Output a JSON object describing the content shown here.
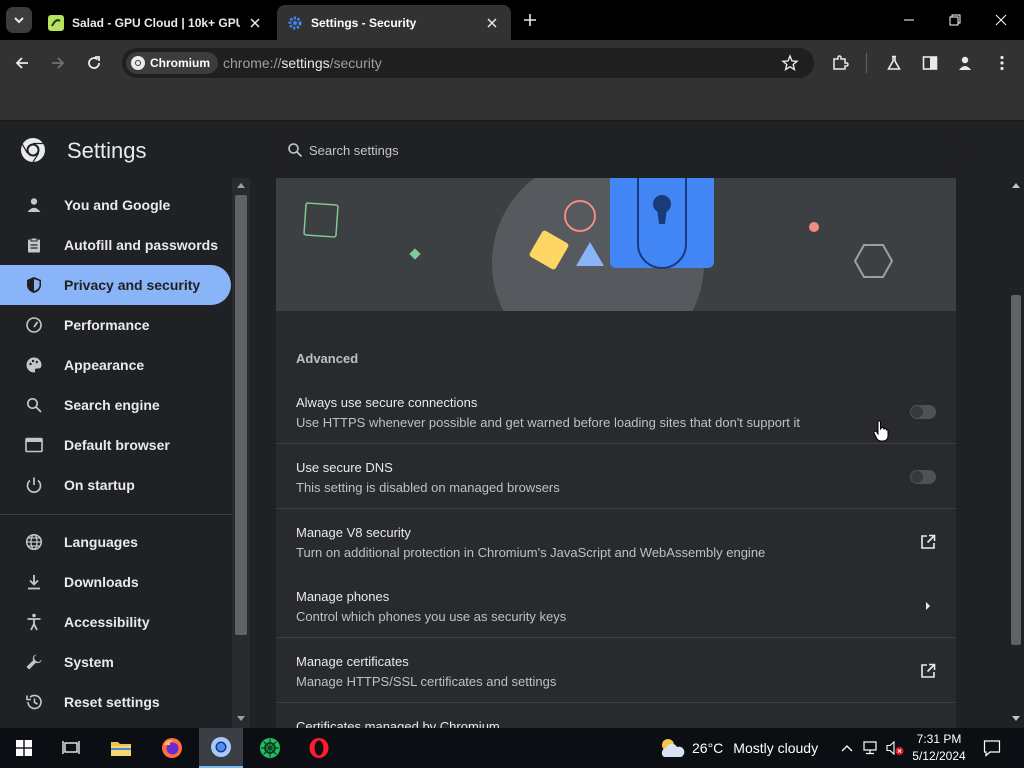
{
  "tabs": [
    {
      "title": "Salad - GPU Cloud | 10k+ GPU",
      "active": false
    },
    {
      "title": "Settings - Security",
      "active": true
    }
  ],
  "toolbar": {
    "site_chip": "Chromium",
    "url_scheme": "chrome://",
    "url_host": "settings",
    "url_path": "/security"
  },
  "header": {
    "title": "Settings",
    "search_placeholder": "Search settings"
  },
  "sidebar": {
    "items": [
      {
        "label": "You and Google",
        "icon": "person-icon",
        "selected": false
      },
      {
        "label": "Autofill and passwords",
        "icon": "clipboard-icon",
        "selected": false
      },
      {
        "label": "Privacy and security",
        "icon": "shield-icon",
        "selected": true
      },
      {
        "label": "Performance",
        "icon": "speedometer-icon",
        "selected": false
      },
      {
        "label": "Appearance",
        "icon": "palette-icon",
        "selected": false
      },
      {
        "label": "Search engine",
        "icon": "search-icon",
        "selected": false
      },
      {
        "label": "Default browser",
        "icon": "browser-icon",
        "selected": false
      },
      {
        "label": "On startup",
        "icon": "power-icon",
        "selected": false
      },
      {
        "label": "Languages",
        "icon": "globe-icon",
        "selected": false
      },
      {
        "label": "Downloads",
        "icon": "download-icon",
        "selected": false
      },
      {
        "label": "Accessibility",
        "icon": "accessibility-icon",
        "selected": false
      },
      {
        "label": "System",
        "icon": "wrench-icon",
        "selected": false
      },
      {
        "label": "Reset settings",
        "icon": "history-icon",
        "selected": false
      }
    ]
  },
  "main": {
    "advanced_heading": "Advanced",
    "rows": [
      {
        "title": "Always use secure connections",
        "subtitle": "Use HTTPS whenever possible and get warned before loading sites that don't support it",
        "control": "toggle",
        "on": false
      },
      {
        "title": "Use secure DNS",
        "subtitle": "This setting is disabled on managed browsers",
        "control": "toggle",
        "on": false
      },
      {
        "title": "Manage V8 security",
        "subtitle": "Turn on additional protection in Chromium's JavaScript and WebAssembly engine",
        "control": "external-link-icon"
      },
      {
        "title": "Manage phones",
        "subtitle": "Control which phones you use as security keys",
        "control": "arrow-right-icon"
      },
      {
        "title": "Manage certificates",
        "subtitle": "Manage HTTPS/SSL certificates and settings",
        "control": "external-link-icon"
      },
      {
        "title": "Certificates managed by Chromium",
        "subtitle": "",
        "control": "none"
      }
    ]
  },
  "taskbar": {
    "weather_temp": "26°C",
    "weather_condition": "Mostly cloudy",
    "time": "7:31 PM",
    "date": "5/12/2024"
  },
  "colors": {
    "accent": "#8ab4f8",
    "background": "#202124",
    "card": "#292a2d"
  }
}
